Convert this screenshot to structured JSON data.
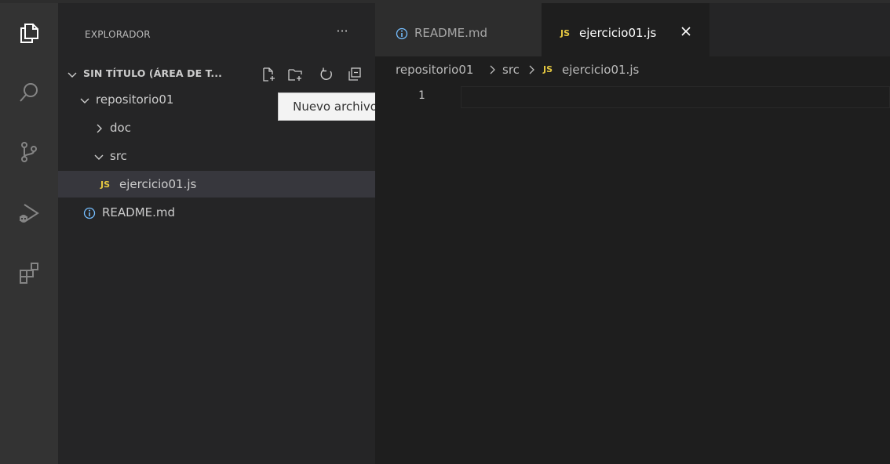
{
  "explorer": {
    "title": "EXPLORADOR",
    "more": "···",
    "section_label": "SIN TÍTULO (ÁREA DE T...",
    "tree": [
      {
        "label": "repositorio01",
        "type": "folder",
        "expanded": true
      },
      {
        "label": "doc",
        "type": "folder",
        "expanded": false
      },
      {
        "label": "src",
        "type": "folder",
        "expanded": true
      },
      {
        "label": "ejercicio01.js",
        "type": "js-file",
        "selected": true
      },
      {
        "label": "README.md",
        "type": "markdown-file"
      }
    ],
    "tooltip": "Nuevo archivo"
  },
  "tabs": [
    {
      "label": "README.md",
      "icon": "info-icon",
      "active": false
    },
    {
      "label": "ejercicio01.js",
      "icon": "js",
      "active": true
    }
  ],
  "js_badge": "JS",
  "breadcrumb": {
    "items": [
      "repositorio01",
      "src",
      "ejercicio01.js"
    ]
  },
  "editor": {
    "line_numbers": [
      "1"
    ]
  },
  "colors": {
    "activity_bar": "#333333",
    "sidebar": "#252526",
    "editor": "#1e1e1e",
    "js_yellow": "#e5c841",
    "info_blue": "#75beff"
  }
}
